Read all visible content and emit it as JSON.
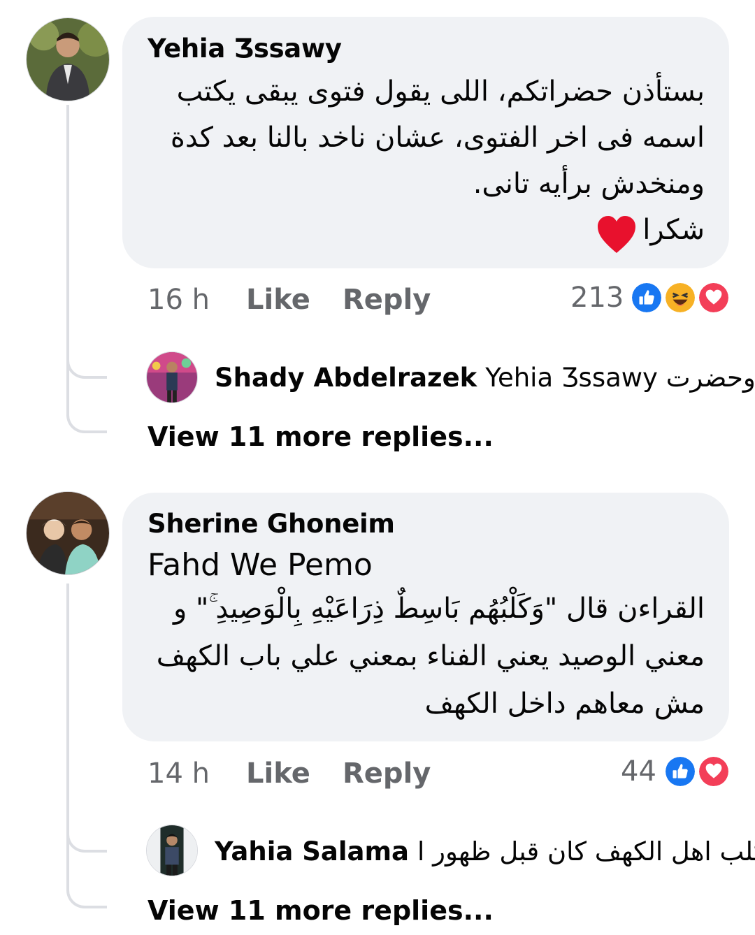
{
  "comments": [
    {
      "author": "Yehia Ʒssawy",
      "lines": [
        "بستأذن حضراتكم، اللى يقول فتوى يبقى يكتب",
        "اسمه فى اخر الفتوى، عشان ناخد بالنا بعد كدة",
        "ومنخدش برأيه تانى.",
        "شكرا"
      ],
      "time": "16 h",
      "like_label": "Like",
      "reply_label": "Reply",
      "reaction_count": "213",
      "reactions": [
        "like-icon",
        "haha-icon",
        "love-icon"
      ],
      "reply_preview": {
        "author": "Shady Abdelrazek",
        "text": "Yehia Ʒssawy وحضرت..."
      },
      "view_more": "View 11 more replies..."
    },
    {
      "author": "Sherine Ghoneim",
      "mention": "Fahd We Pemo",
      "lines": [
        "القراءن قال \"وَكَلْبُهُم بَاسِطٌ ذِرَاعَيْهِ بِالْوَصِيدِ ۚ\" و",
        "معني الوصيد يعني الفناء بمعني علي باب الكهف",
        "مش معاهم داخل الكهف"
      ],
      "time": "14 h",
      "like_label": "Like",
      "reply_label": "Reply",
      "reaction_count": "44",
      "reactions": [
        "like-icon",
        "love-icon"
      ],
      "reply_preview": {
        "author": "Yahia Salama",
        "text": "كلب اهل الكهف كان قبل ظهور ا..."
      },
      "view_more": "View 11 more replies..."
    }
  ],
  "colors": {
    "bubble": "#f0f2f5",
    "meta": "#65676b",
    "text": "#050505",
    "like_blue": "#1877f2",
    "love_red": "#f33e58",
    "haha_yellow": "#f7b125"
  }
}
